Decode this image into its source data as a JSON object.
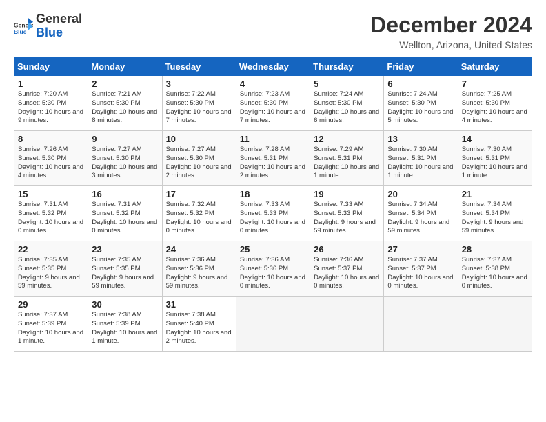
{
  "logo": {
    "text_general": "General",
    "text_blue": "Blue"
  },
  "header": {
    "month": "December 2024",
    "location": "Wellton, Arizona, United States"
  },
  "weekdays": [
    "Sunday",
    "Monday",
    "Tuesday",
    "Wednesday",
    "Thursday",
    "Friday",
    "Saturday"
  ],
  "weeks": [
    [
      {
        "day": "1",
        "sunrise": "Sunrise: 7:20 AM",
        "sunset": "Sunset: 5:30 PM",
        "daylight": "Daylight: 10 hours and 9 minutes."
      },
      {
        "day": "2",
        "sunrise": "Sunrise: 7:21 AM",
        "sunset": "Sunset: 5:30 PM",
        "daylight": "Daylight: 10 hours and 8 minutes."
      },
      {
        "day": "3",
        "sunrise": "Sunrise: 7:22 AM",
        "sunset": "Sunset: 5:30 PM",
        "daylight": "Daylight: 10 hours and 7 minutes."
      },
      {
        "day": "4",
        "sunrise": "Sunrise: 7:23 AM",
        "sunset": "Sunset: 5:30 PM",
        "daylight": "Daylight: 10 hours and 7 minutes."
      },
      {
        "day": "5",
        "sunrise": "Sunrise: 7:24 AM",
        "sunset": "Sunset: 5:30 PM",
        "daylight": "Daylight: 10 hours and 6 minutes."
      },
      {
        "day": "6",
        "sunrise": "Sunrise: 7:24 AM",
        "sunset": "Sunset: 5:30 PM",
        "daylight": "Daylight: 10 hours and 5 minutes."
      },
      {
        "day": "7",
        "sunrise": "Sunrise: 7:25 AM",
        "sunset": "Sunset: 5:30 PM",
        "daylight": "Daylight: 10 hours and 4 minutes."
      }
    ],
    [
      {
        "day": "8",
        "sunrise": "Sunrise: 7:26 AM",
        "sunset": "Sunset: 5:30 PM",
        "daylight": "Daylight: 10 hours and 4 minutes."
      },
      {
        "day": "9",
        "sunrise": "Sunrise: 7:27 AM",
        "sunset": "Sunset: 5:30 PM",
        "daylight": "Daylight: 10 hours and 3 minutes."
      },
      {
        "day": "10",
        "sunrise": "Sunrise: 7:27 AM",
        "sunset": "Sunset: 5:30 PM",
        "daylight": "Daylight: 10 hours and 2 minutes."
      },
      {
        "day": "11",
        "sunrise": "Sunrise: 7:28 AM",
        "sunset": "Sunset: 5:31 PM",
        "daylight": "Daylight: 10 hours and 2 minutes."
      },
      {
        "day": "12",
        "sunrise": "Sunrise: 7:29 AM",
        "sunset": "Sunset: 5:31 PM",
        "daylight": "Daylight: 10 hours and 1 minute."
      },
      {
        "day": "13",
        "sunrise": "Sunrise: 7:30 AM",
        "sunset": "Sunset: 5:31 PM",
        "daylight": "Daylight: 10 hours and 1 minute."
      },
      {
        "day": "14",
        "sunrise": "Sunrise: 7:30 AM",
        "sunset": "Sunset: 5:31 PM",
        "daylight": "Daylight: 10 hours and 1 minute."
      }
    ],
    [
      {
        "day": "15",
        "sunrise": "Sunrise: 7:31 AM",
        "sunset": "Sunset: 5:32 PM",
        "daylight": "Daylight: 10 hours and 0 minutes."
      },
      {
        "day": "16",
        "sunrise": "Sunrise: 7:31 AM",
        "sunset": "Sunset: 5:32 PM",
        "daylight": "Daylight: 10 hours and 0 minutes."
      },
      {
        "day": "17",
        "sunrise": "Sunrise: 7:32 AM",
        "sunset": "Sunset: 5:32 PM",
        "daylight": "Daylight: 10 hours and 0 minutes."
      },
      {
        "day": "18",
        "sunrise": "Sunrise: 7:33 AM",
        "sunset": "Sunset: 5:33 PM",
        "daylight": "Daylight: 10 hours and 0 minutes."
      },
      {
        "day": "19",
        "sunrise": "Sunrise: 7:33 AM",
        "sunset": "Sunset: 5:33 PM",
        "daylight": "Daylight: 9 hours and 59 minutes."
      },
      {
        "day": "20",
        "sunrise": "Sunrise: 7:34 AM",
        "sunset": "Sunset: 5:34 PM",
        "daylight": "Daylight: 9 hours and 59 minutes."
      },
      {
        "day": "21",
        "sunrise": "Sunrise: 7:34 AM",
        "sunset": "Sunset: 5:34 PM",
        "daylight": "Daylight: 9 hours and 59 minutes."
      }
    ],
    [
      {
        "day": "22",
        "sunrise": "Sunrise: 7:35 AM",
        "sunset": "Sunset: 5:35 PM",
        "daylight": "Daylight: 9 hours and 59 minutes."
      },
      {
        "day": "23",
        "sunrise": "Sunrise: 7:35 AM",
        "sunset": "Sunset: 5:35 PM",
        "daylight": "Daylight: 9 hours and 59 minutes."
      },
      {
        "day": "24",
        "sunrise": "Sunrise: 7:36 AM",
        "sunset": "Sunset: 5:36 PM",
        "daylight": "Daylight: 9 hours and 59 minutes."
      },
      {
        "day": "25",
        "sunrise": "Sunrise: 7:36 AM",
        "sunset": "Sunset: 5:36 PM",
        "daylight": "Daylight: 10 hours and 0 minutes."
      },
      {
        "day": "26",
        "sunrise": "Sunrise: 7:36 AM",
        "sunset": "Sunset: 5:37 PM",
        "daylight": "Daylight: 10 hours and 0 minutes."
      },
      {
        "day": "27",
        "sunrise": "Sunrise: 7:37 AM",
        "sunset": "Sunset: 5:37 PM",
        "daylight": "Daylight: 10 hours and 0 minutes."
      },
      {
        "day": "28",
        "sunrise": "Sunrise: 7:37 AM",
        "sunset": "Sunset: 5:38 PM",
        "daylight": "Daylight: 10 hours and 0 minutes."
      }
    ],
    [
      {
        "day": "29",
        "sunrise": "Sunrise: 7:37 AM",
        "sunset": "Sunset: 5:39 PM",
        "daylight": "Daylight: 10 hours and 1 minute."
      },
      {
        "day": "30",
        "sunrise": "Sunrise: 7:38 AM",
        "sunset": "Sunset: 5:39 PM",
        "daylight": "Daylight: 10 hours and 1 minute."
      },
      {
        "day": "31",
        "sunrise": "Sunrise: 7:38 AM",
        "sunset": "Sunset: 5:40 PM",
        "daylight": "Daylight: 10 hours and 2 minutes."
      },
      null,
      null,
      null,
      null
    ]
  ]
}
